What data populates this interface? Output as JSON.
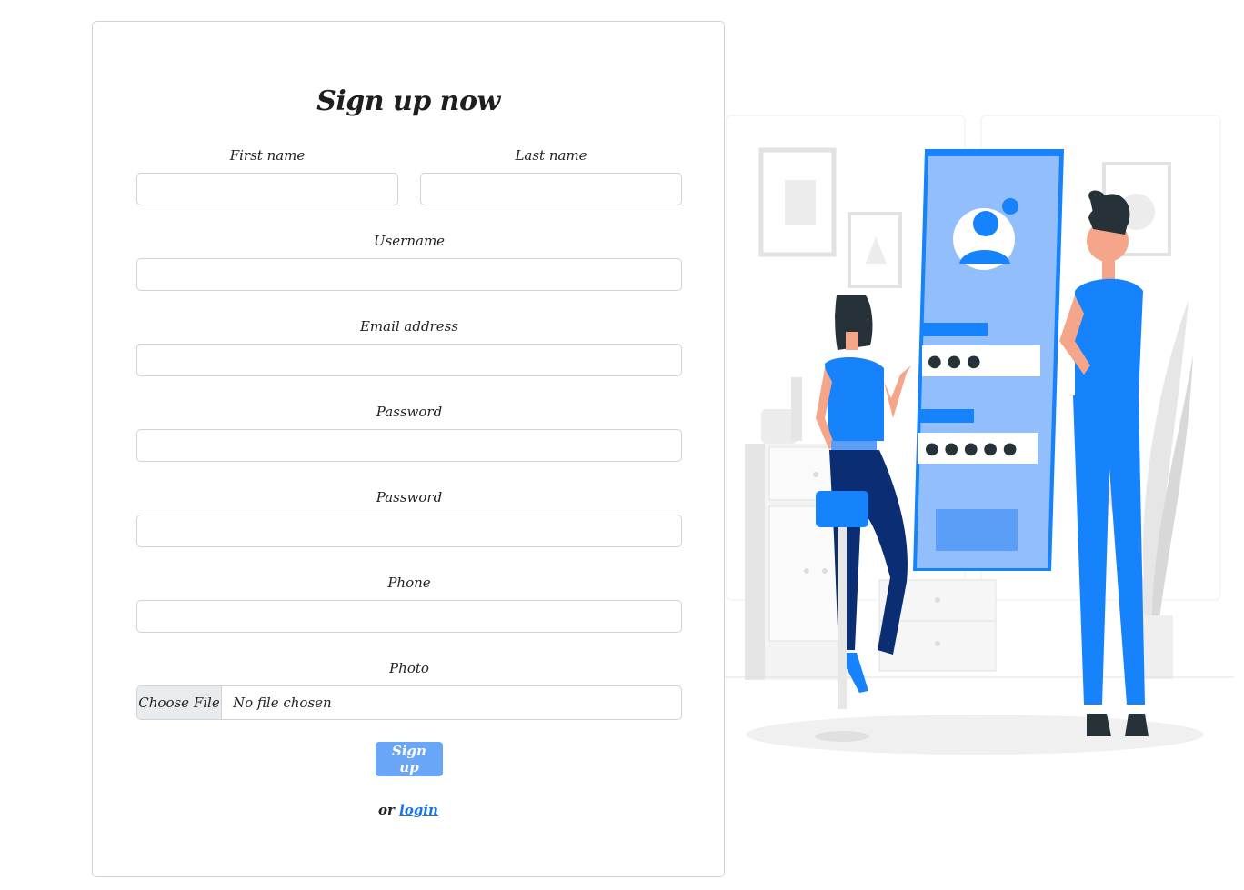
{
  "form": {
    "title": "Sign up now",
    "first_name_label": "First name",
    "last_name_label": "Last name",
    "username_label": "Username",
    "email_label": "Email address",
    "password_label": "Password",
    "password_confirm_label": "Password",
    "phone_label": "Phone",
    "photo_label": "Photo",
    "photo_button": "Choose File",
    "photo_status": "No file chosen",
    "submit_label": "Sign up",
    "alt_prefix": "or",
    "alt_link": "login"
  },
  "illustration": {
    "password_masks": [
      "● ● ●",
      "● ● ● ● ●"
    ]
  },
  "colors": {
    "accent": "#1a73e8",
    "button": "#69a6f7",
    "illustration_blue": "#1682fb"
  }
}
